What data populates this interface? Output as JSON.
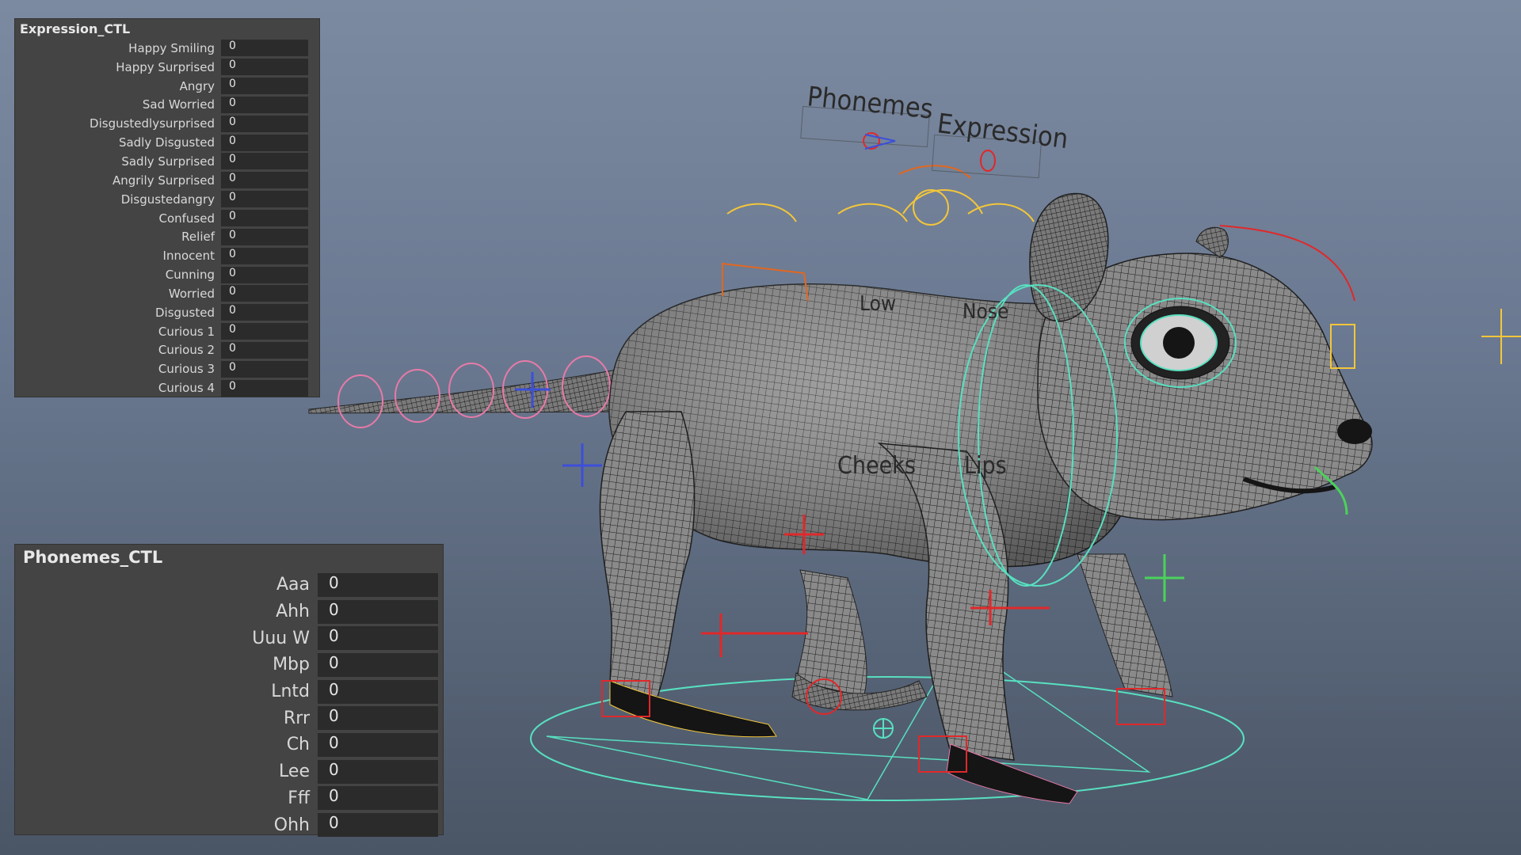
{
  "expression_panel": {
    "title": "Expression_CTL",
    "attributes": [
      {
        "label": "Happy Smiling",
        "value": "0"
      },
      {
        "label": "Happy Surprised",
        "value": "0"
      },
      {
        "label": "Angry",
        "value": "0"
      },
      {
        "label": "Sad Worried",
        "value": "0"
      },
      {
        "label": "Disgustedlysurprised",
        "value": "0"
      },
      {
        "label": "Sadly Disgusted",
        "value": "0"
      },
      {
        "label": "Sadly Surprised",
        "value": "0"
      },
      {
        "label": "Angrily Surprised",
        "value": "0"
      },
      {
        "label": "Disgustedangry",
        "value": "0"
      },
      {
        "label": "Confused",
        "value": "0"
      },
      {
        "label": "Relief",
        "value": "0"
      },
      {
        "label": "Innocent",
        "value": "0"
      },
      {
        "label": "Cunning",
        "value": "0"
      },
      {
        "label": "Worried",
        "value": "0"
      },
      {
        "label": "Disgusted",
        "value": "0"
      },
      {
        "label": "Curious 1",
        "value": "0"
      },
      {
        "label": "Curious 2",
        "value": "0"
      },
      {
        "label": "Curious 3",
        "value": "0"
      },
      {
        "label": "Curious 4",
        "value": "0"
      }
    ]
  },
  "phonemes_panel": {
    "title": "Phonemes_CTL",
    "attributes": [
      {
        "label": "Aaa",
        "value": "0"
      },
      {
        "label": "Ahh",
        "value": "0"
      },
      {
        "label": "Uuu W",
        "value": "0"
      },
      {
        "label": "Mbp",
        "value": "0"
      },
      {
        "label": "Lntd",
        "value": "0"
      },
      {
        "label": "Rrr",
        "value": "0"
      },
      {
        "label": "Ch",
        "value": "0"
      },
      {
        "label": "Lee",
        "value": "0"
      },
      {
        "label": "Fff",
        "value": "0"
      },
      {
        "label": "Ohh",
        "value": "0"
      }
    ]
  },
  "viewport": {
    "label_phonemes": "Phonemes",
    "label_expression": "Expression",
    "label_cheeks": "Cheeks",
    "label_lips": "Lips",
    "label_low": "Low",
    "label_nose": "Nose"
  },
  "colors": {
    "panel_bg": "#444444",
    "field_bg": "#2b2b2b",
    "mesh_fill": "#8e8e8e",
    "mesh_line": "#1e1e1e",
    "ctl_red": "#e0282a",
    "ctl_yellow": "#f3c63a",
    "ctl_cyan": "#58e0c0",
    "ctl_pink": "#e87aa8",
    "ctl_blue": "#3c4fd8",
    "ctl_green": "#4ad35a"
  }
}
